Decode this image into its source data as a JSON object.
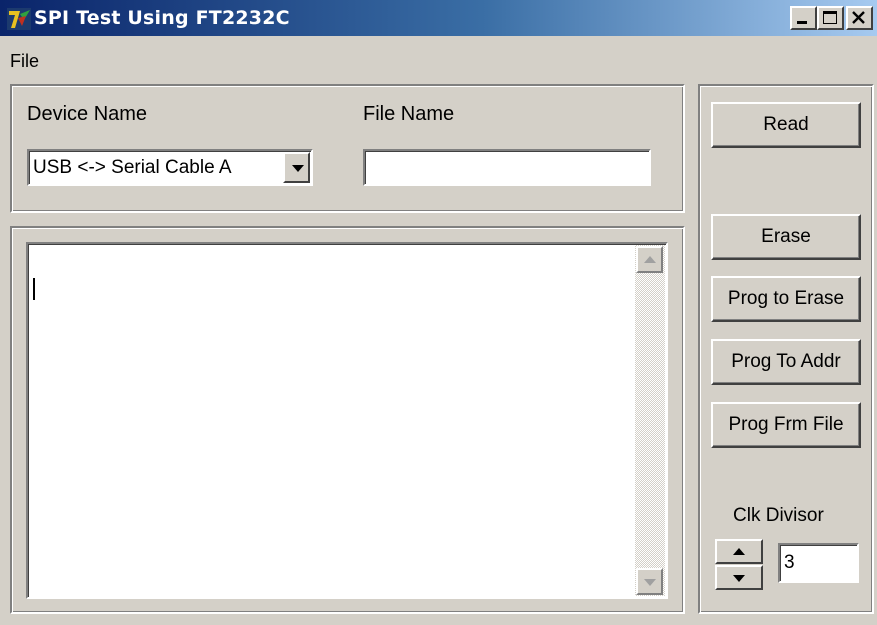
{
  "window": {
    "title": "SPI Test Using FT2232C",
    "app_icon": "delphi-icon",
    "controls": [
      "minimize-icon",
      "maximize-icon",
      "close-icon"
    ]
  },
  "menu": {
    "file": "File"
  },
  "device": {
    "label": "Device Name",
    "selected": "USB <-> Serial Cable A"
  },
  "file": {
    "label": "File Name",
    "value": ""
  },
  "output": {
    "text": ""
  },
  "buttons": {
    "read": "Read",
    "erase": "Erase",
    "prog_to_erase": "Prog to Erase",
    "prog_to_addr": "Prog To Addr",
    "prog_frm_file": "Prog Frm File"
  },
  "clock": {
    "label": "Clk Divisor",
    "value": "3"
  },
  "colors": {
    "window_face": "#d4d0c8",
    "titlebar_start": "#0a246a",
    "titlebar_end": "#a6caf0"
  }
}
